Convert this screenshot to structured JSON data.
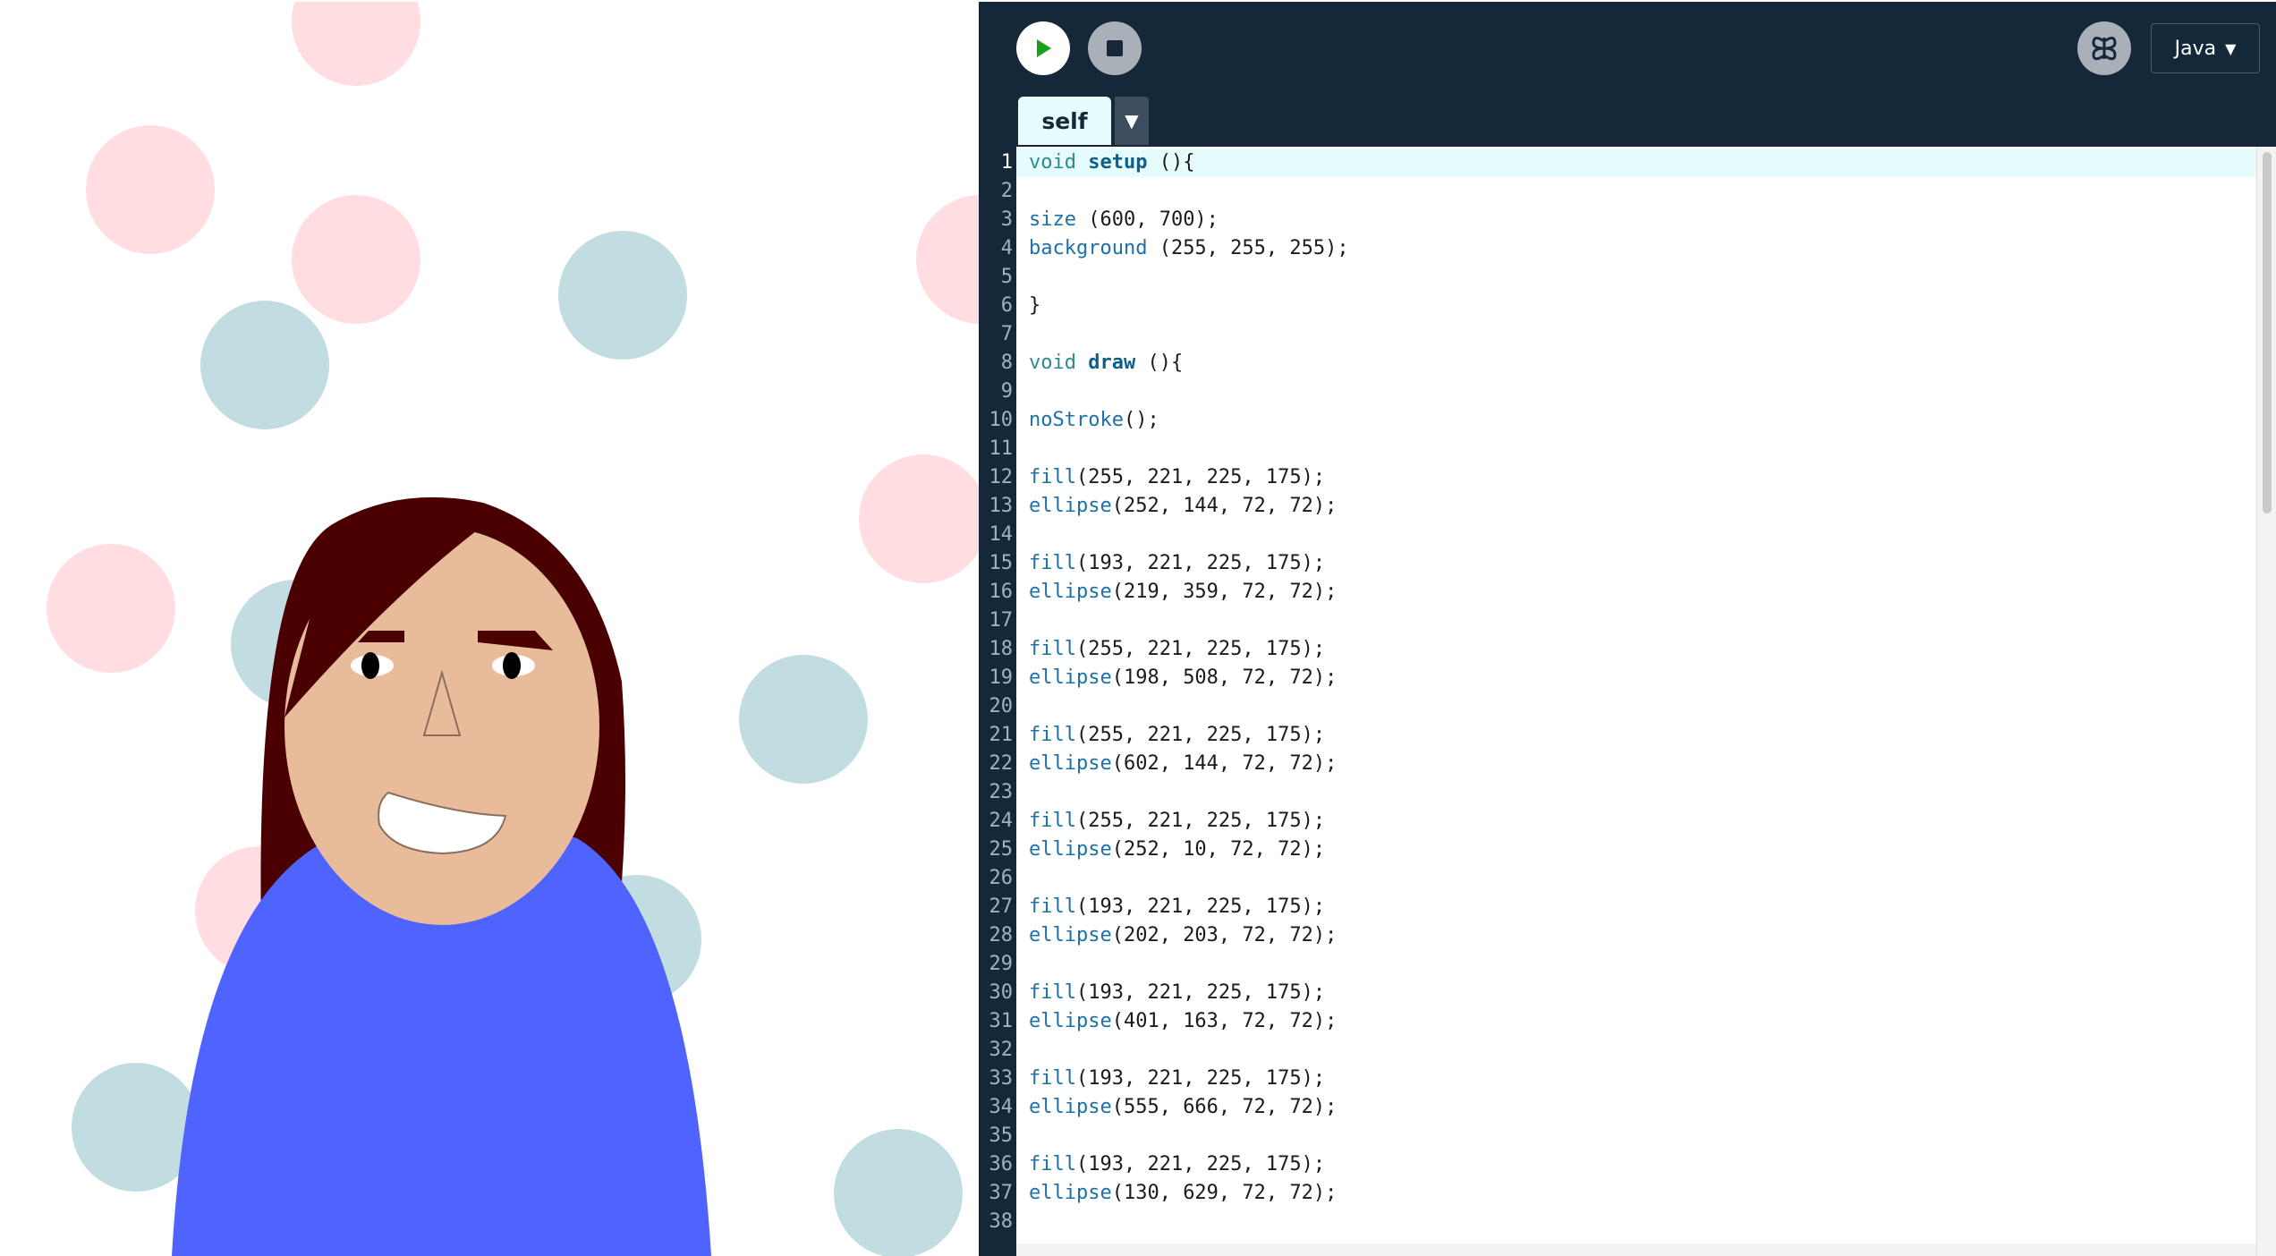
{
  "toolbar": {
    "language_label": "Java",
    "caret": "▼"
  },
  "tabs": [
    {
      "label": "self",
      "active": true
    }
  ],
  "tab_menu_glyph": "▼",
  "icons": {
    "run": "play-icon",
    "stop": "stop-icon",
    "mode": "butterfly-icon"
  },
  "colors": {
    "editor_bg": "#14283a",
    "run_green": "#1aa01a",
    "pink_circle": "#ffdde1",
    "teal_circle": "#c1dde1",
    "hair": "#4a0000",
    "skin": "#e8bc9a",
    "shirt": "#4f63ff"
  },
  "code_lines": [
    {
      "n": "1",
      "parts": [
        {
          "t": "void",
          "c": "kw"
        },
        {
          "t": " "
        },
        {
          "t": "setup",
          "c": "fn"
        },
        {
          "t": " (){"
        }
      ]
    },
    {
      "n": "2",
      "parts": []
    },
    {
      "n": "3",
      "parts": [
        {
          "t": "size",
          "c": "api"
        },
        {
          "t": " (600, 700);"
        }
      ]
    },
    {
      "n": "4",
      "parts": [
        {
          "t": "background",
          "c": "api"
        },
        {
          "t": " (255, 255, 255);"
        }
      ]
    },
    {
      "n": "5",
      "parts": []
    },
    {
      "n": "6",
      "parts": [
        {
          "t": "}"
        }
      ]
    },
    {
      "n": "7",
      "parts": []
    },
    {
      "n": "8",
      "parts": [
        {
          "t": "void",
          "c": "kw"
        },
        {
          "t": " "
        },
        {
          "t": "draw",
          "c": "fn"
        },
        {
          "t": " (){"
        }
      ]
    },
    {
      "n": "9",
      "parts": []
    },
    {
      "n": "10",
      "parts": [
        {
          "t": "noStroke",
          "c": "api"
        },
        {
          "t": "();"
        }
      ]
    },
    {
      "n": "11",
      "parts": []
    },
    {
      "n": "12",
      "parts": [
        {
          "t": "fill",
          "c": "api"
        },
        {
          "t": "(255, 221, 225, 175);"
        }
      ]
    },
    {
      "n": "13",
      "parts": [
        {
          "t": "ellipse",
          "c": "api"
        },
        {
          "t": "(252, 144, 72, 72);"
        }
      ]
    },
    {
      "n": "14",
      "parts": []
    },
    {
      "n": "15",
      "parts": [
        {
          "t": "fill",
          "c": "api"
        },
        {
          "t": "(193, 221, 225, 175);"
        }
      ]
    },
    {
      "n": "16",
      "parts": [
        {
          "t": "ellipse",
          "c": "api"
        },
        {
          "t": "(219, 359, 72, 72);"
        }
      ]
    },
    {
      "n": "17",
      "parts": []
    },
    {
      "n": "18",
      "parts": [
        {
          "t": "fill",
          "c": "api"
        },
        {
          "t": "(255, 221, 225, 175);"
        }
      ]
    },
    {
      "n": "19",
      "parts": [
        {
          "t": "ellipse",
          "c": "api"
        },
        {
          "t": "(198, 508, 72, 72);"
        }
      ]
    },
    {
      "n": "20",
      "parts": []
    },
    {
      "n": "21",
      "parts": [
        {
          "t": "fill",
          "c": "api"
        },
        {
          "t": "(255, 221, 225, 175);"
        }
      ]
    },
    {
      "n": "22",
      "parts": [
        {
          "t": "ellipse",
          "c": "api"
        },
        {
          "t": "(602, 144, 72, 72);"
        }
      ]
    },
    {
      "n": "23",
      "parts": []
    },
    {
      "n": "24",
      "parts": [
        {
          "t": "fill",
          "c": "api"
        },
        {
          "t": "(255, 221, 225, 175);"
        }
      ]
    },
    {
      "n": "25",
      "parts": [
        {
          "t": "ellipse",
          "c": "api"
        },
        {
          "t": "(252, 10, 72, 72);"
        }
      ]
    },
    {
      "n": "26",
      "parts": []
    },
    {
      "n": "27",
      "parts": [
        {
          "t": "fill",
          "c": "api"
        },
        {
          "t": "(193, 221, 225, 175);"
        }
      ]
    },
    {
      "n": "28",
      "parts": [
        {
          "t": "ellipse",
          "c": "api"
        },
        {
          "t": "(202, 203, 72, 72);"
        }
      ]
    },
    {
      "n": "29",
      "parts": []
    },
    {
      "n": "30",
      "parts": [
        {
          "t": "fill",
          "c": "api"
        },
        {
          "t": "(193, 221, 225, 175);"
        }
      ]
    },
    {
      "n": "31",
      "parts": [
        {
          "t": "ellipse",
          "c": "api"
        },
        {
          "t": "(401, 163, 72, 72);"
        }
      ]
    },
    {
      "n": "32",
      "parts": []
    },
    {
      "n": "33",
      "parts": [
        {
          "t": "fill",
          "c": "api"
        },
        {
          "t": "(193, 221, 225, 175);"
        }
      ]
    },
    {
      "n": "34",
      "parts": [
        {
          "t": "ellipse",
          "c": "api"
        },
        {
          "t": "(555, 666, 72, 72);"
        }
      ]
    },
    {
      "n": "35",
      "parts": []
    },
    {
      "n": "36",
      "parts": [
        {
          "t": "fill",
          "c": "api"
        },
        {
          "t": "(193, 221, 225, 175);"
        }
      ]
    },
    {
      "n": "37",
      "parts": [
        {
          "t": "ellipse",
          "c": "api"
        },
        {
          "t": "(130, 629, 72, 72);"
        }
      ]
    },
    {
      "n": "38",
      "parts": []
    }
  ]
}
